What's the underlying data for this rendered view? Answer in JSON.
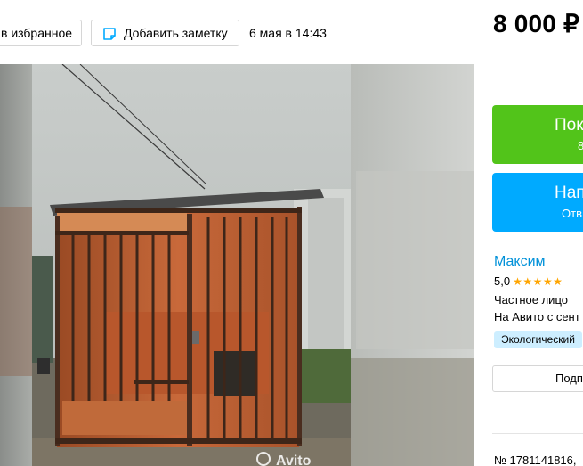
{
  "toolbar": {
    "favorite_label": "в избранное",
    "note_label": "Добавить заметку",
    "date": "6 мая в 14:43"
  },
  "price": "8 000 ₽",
  "gallery": {
    "watermark": "Avito"
  },
  "actions": {
    "call_main": "Пок",
    "call_sub": "8",
    "write_main": "Напи",
    "write_sub": "Отв"
  },
  "seller": {
    "name": "Максим",
    "rating": "5,0",
    "stars": "★★★★★",
    "type": "Частное лицо",
    "since": "На Авито с сент",
    "badge": "Экологический",
    "subscribe_label": "Подп"
  },
  "item": {
    "number": "№ 1781141816,"
  },
  "colors": {
    "green": "#52c41a",
    "blue": "#00aaff",
    "link": "#0091d9",
    "star": "#ffa500",
    "badge_bg": "#cdeeff"
  },
  "icons": {
    "note": "note-icon"
  }
}
